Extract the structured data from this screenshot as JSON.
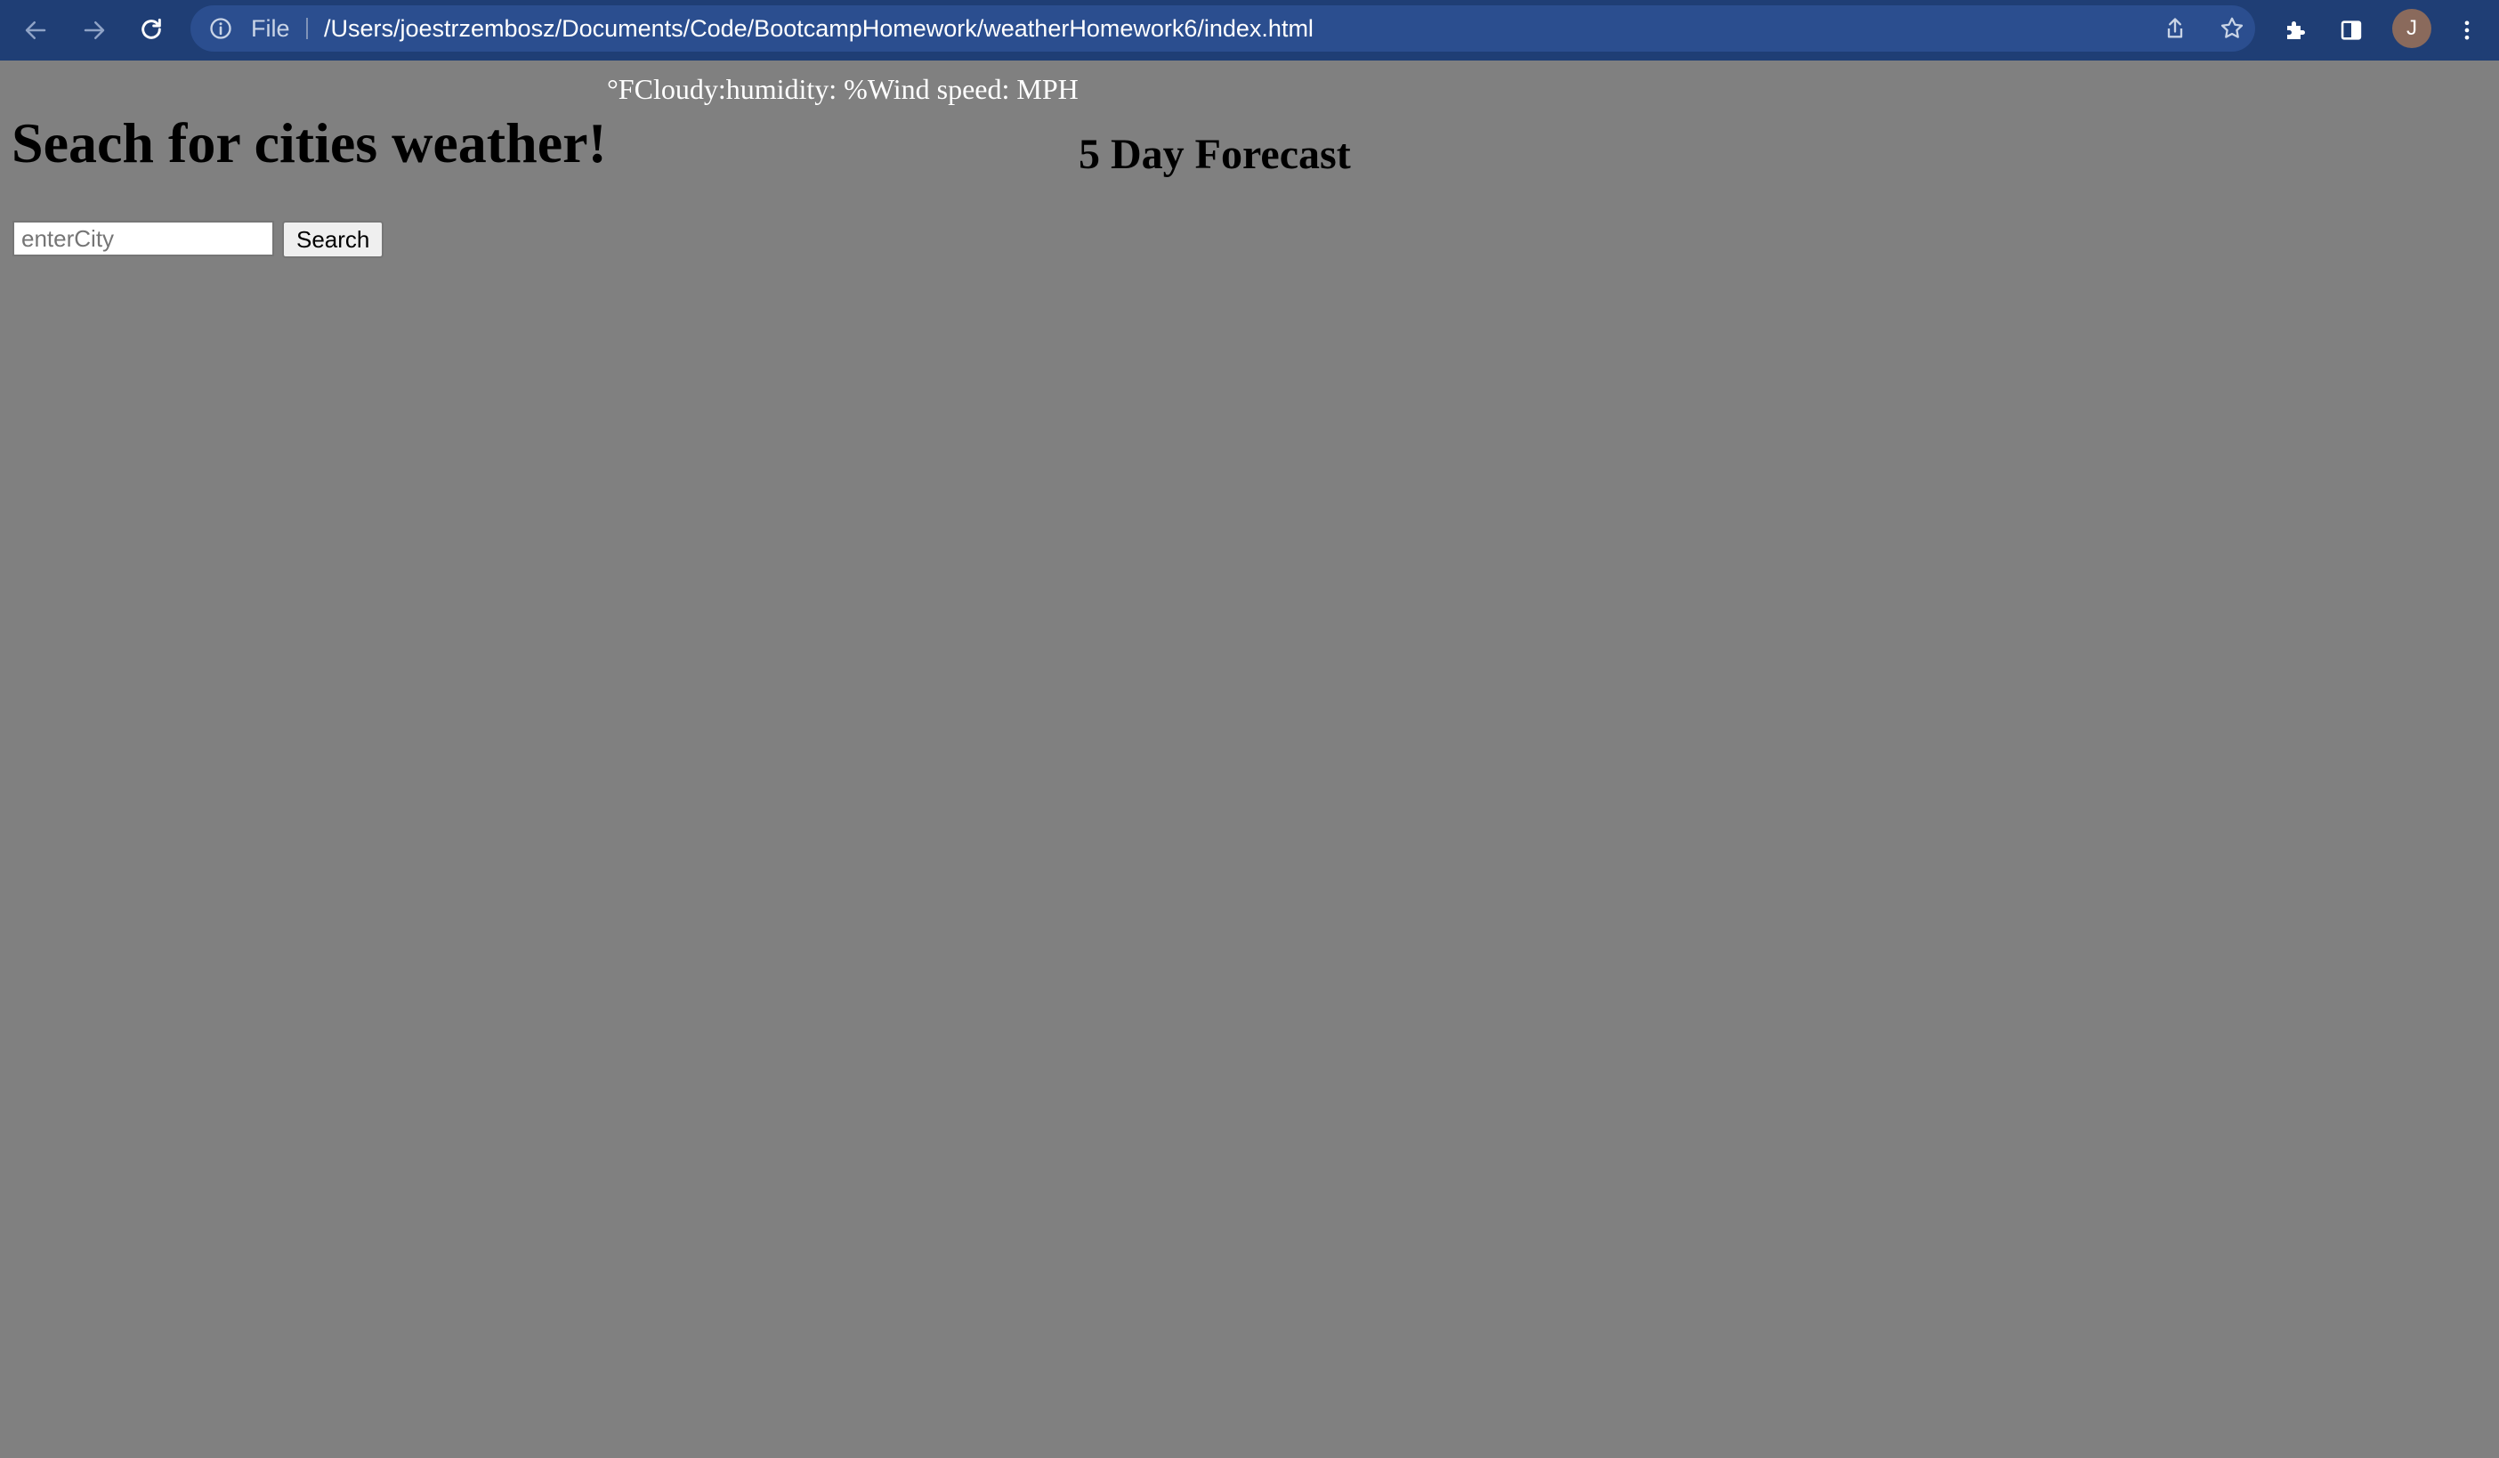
{
  "browser": {
    "omnibox": {
      "scheme_label": "File",
      "url": "/Users/joestrzembosz/Documents/Code/BootcampHomework/weatherHomework6/index.html"
    },
    "profile_initial": "J",
    "icons": [
      "back-arrow-icon",
      "forward-arrow-icon",
      "reload-icon",
      "info-icon",
      "share-icon",
      "star-icon",
      "extensions-puzzle-icon",
      "side-panel-icon",
      "kebab-menu-icon"
    ]
  },
  "page": {
    "current_weather_text": "°FCloudy:humidity: %Wind speed: MPH",
    "title": "Seach for cities weather!",
    "forecast_title": "5 Day Forecast",
    "search": {
      "placeholder": "enterCity",
      "value": "",
      "button_label": "Search"
    }
  },
  "colors": {
    "toolbar_bg": "#1f3e75",
    "omnibox_bg": "#2b4e8f",
    "page_bg": "#808080",
    "current_weather_text": "#ffffff"
  }
}
